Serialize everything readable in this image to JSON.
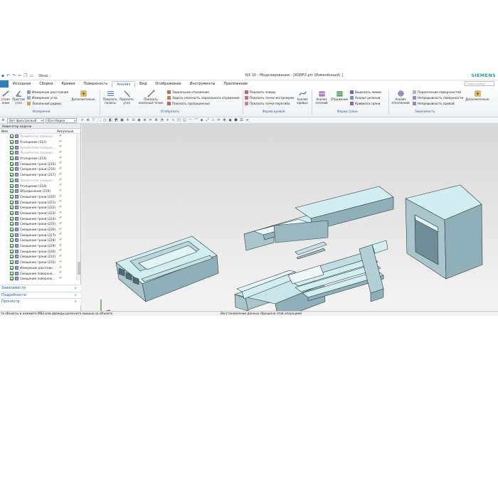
{
  "titlebar": {
    "commands_label": "Окно",
    "title": "NX 10 - Моделирование - [KONF2.prt (Изменённый) ]",
    "brand": "SIEMENS"
  },
  "menu": {
    "tabs": [
      "Исходная",
      "Сборки",
      "Кривая",
      "Поверхность",
      "Анализ",
      "Вид",
      "Отображение",
      "Инструменты",
      "Приложение"
    ],
    "active_tab": "Анализ",
    "search_placeholder": "Поиск команд"
  },
  "ribbon": {
    "b_dist": "стоян\nение",
    "b_simple_angle": "Простой\nугол",
    "measure_items": [
      "Измерение расстояния",
      "Измерение угла",
      "Локальный радиус"
    ],
    "b_more1": "Дополнительно",
    "b_show_strip": "Показать\nполосы",
    "b_show_angle": "Показать\nугол",
    "b_show_end": "Показать\nконечные точки",
    "display_items": [
      "Зеркальное отражение",
      "Задать плоскость зеркального отражения",
      "Показать пропущенные"
    ],
    "curve_items": [
      "Показать эпюры",
      "Показать точки экстремума",
      "Показать точки перегиба"
    ],
    "b_curve_analysis": "Анализ\nкривых",
    "b_face_analysis": "Анализ\nсечений",
    "b_reflection": "Отражение",
    "face_items": [
      "Выделить линии",
      "Анализ уклонов",
      "Кривизна грани"
    ],
    "b_deviation": "Анализ\nотклонений",
    "dep_items": [
      "Пересечение поверхностей",
      "Непрерывность поверхности",
      "Непрерывность кривой"
    ],
    "b_more2": "Дополнительно",
    "groups": [
      "Измерение",
      "Отобразить",
      "Форма кривой",
      "Форма грани",
      "Зависимость"
    ]
  },
  "selection": {
    "filter": "Нет фильтра выб",
    "scope": "Вся сборка"
  },
  "navigator": {
    "title": "Навигатор модели",
    "col_name": "Имя",
    "col_state": "Актуально",
    "rows": [
      {
        "label": "Линейчатая поверхн...",
        "dim": true
      },
      {
        "label": "Утолщение (212)",
        "dim": false
      },
      {
        "label": "Линейчатая поверхн...",
        "dim": true
      },
      {
        "label": "Линейчатая поверхн...",
        "dim": true
      },
      {
        "label": "Утолщение (214)",
        "dim": false
      },
      {
        "label": "Смещение грани (215)",
        "dim": false
      },
      {
        "label": "Смещение грани (216)",
        "dim": false
      },
      {
        "label": "Смещение грани (217)",
        "dim": false
      },
      {
        "label": "Линейчатая поверхн...",
        "dim": true
      },
      {
        "label": "Утолщение (218)",
        "dim": false
      },
      {
        "label": "Объединение (219)",
        "dim": false
      },
      {
        "label": "Смещение грани (220)",
        "dim": false
      },
      {
        "label": "Смещение грани (221)",
        "dim": false
      },
      {
        "label": "Смещение грани (222)",
        "dim": false
      },
      {
        "label": "Смещение грани (223)",
        "dim": false
      },
      {
        "label": "Смещение грани (224)",
        "dim": false
      },
      {
        "label": "Смещение грани (225)",
        "dim": false
      },
      {
        "label": "Смещение грани (226)",
        "dim": false
      },
      {
        "label": "Смещение грани (227)",
        "dim": false
      },
      {
        "label": "Смещение грани (228)",
        "dim": false
      },
      {
        "label": "Смещение грани (229)",
        "dim": false
      },
      {
        "label": "Смещение грани (230)",
        "dim": false
      },
      {
        "label": "Смещение грани (231)",
        "dim": false
      },
      {
        "label": "Смещение грани (232)",
        "dim": false
      },
      {
        "label": "Измерение расстоян...",
        "dim": false
      },
      {
        "label": "Смещение поверхно...",
        "dim": false
      },
      {
        "label": "Смещение поверхно...",
        "dim": false
      }
    ],
    "panels": [
      "Зависимости",
      "Подробности",
      "Просмотр"
    ]
  },
  "status": {
    "left": "те объекты и нажмите MB3 или дважды щелкните мышью на объекте",
    "right": "Восстановление данных сброшено этой операцией"
  },
  "colors": {
    "accent": "#1a5b9a",
    "file_tab": "#2a7fbf",
    "part_top": "#d2eef2",
    "part_side": "#aac6cc",
    "part_dark": "#7e9aa2",
    "check_green": "#2aa02a"
  }
}
